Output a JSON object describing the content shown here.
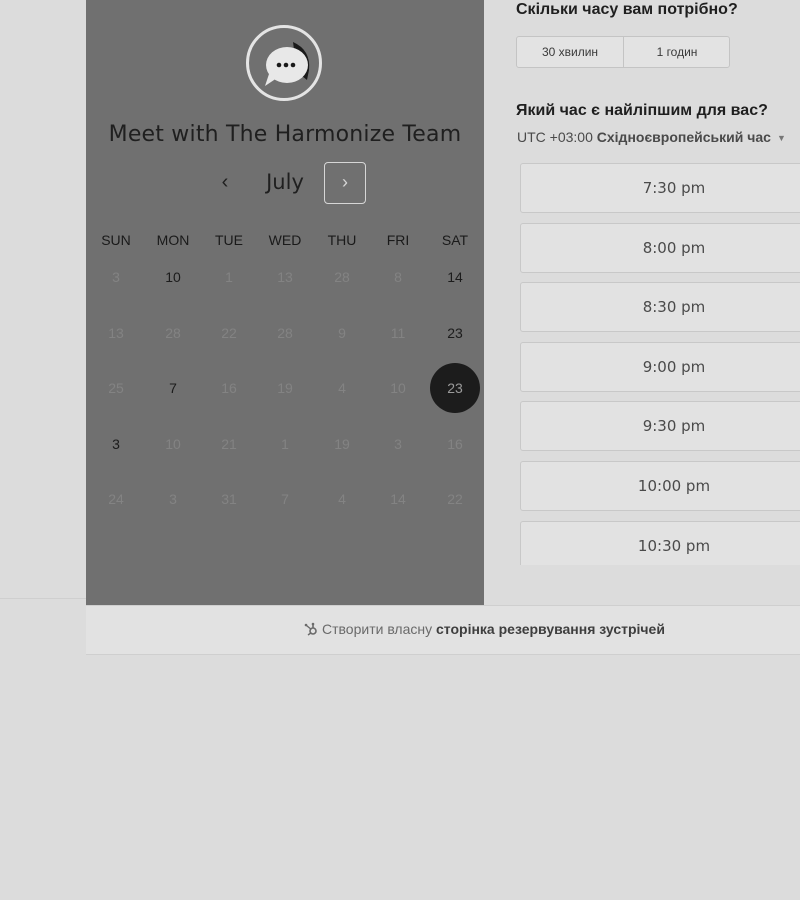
{
  "left_panel": {
    "logo_icon": "chat-bubble-icon",
    "title": "Meet with The Harmonize Team",
    "month": "July",
    "prev_icon": "‹",
    "next_icon": "›",
    "day_headers": [
      "SUN",
      "MON",
      "TUE",
      "WED",
      "THU",
      "FRI",
      "SAT"
    ],
    "weeks": [
      [
        {
          "d": "3",
          "a": false
        },
        {
          "d": "10",
          "a": true
        },
        {
          "d": "1",
          "a": false
        },
        {
          "d": "13",
          "a": false
        },
        {
          "d": "28",
          "a": false
        },
        {
          "d": "8",
          "a": false
        },
        {
          "d": "14",
          "a": true
        }
      ],
      [
        {
          "d": "13",
          "a": false
        },
        {
          "d": "28",
          "a": false
        },
        {
          "d": "22",
          "a": false
        },
        {
          "d": "28",
          "a": false
        },
        {
          "d": "9",
          "a": false
        },
        {
          "d": "11",
          "a": false
        },
        {
          "d": "23",
          "a": true
        }
      ],
      [
        {
          "d": "25",
          "a": false
        },
        {
          "d": "7",
          "a": true
        },
        {
          "d": "16",
          "a": false
        },
        {
          "d": "19",
          "a": false
        },
        {
          "d": "4",
          "a": false
        },
        {
          "d": "10",
          "a": false
        },
        {
          "d": "23",
          "a": true,
          "s": true
        }
      ],
      [
        {
          "d": "3",
          "a": true
        },
        {
          "d": "10",
          "a": false
        },
        {
          "d": "21",
          "a": false
        },
        {
          "d": "1",
          "a": false
        },
        {
          "d": "19",
          "a": false
        },
        {
          "d": "3",
          "a": false
        },
        {
          "d": "16",
          "a": false
        }
      ],
      [
        {
          "d": "24",
          "a": false
        },
        {
          "d": "3",
          "a": false
        },
        {
          "d": "31",
          "a": false
        },
        {
          "d": "7",
          "a": false
        },
        {
          "d": "4",
          "a": false
        },
        {
          "d": "14",
          "a": false
        },
        {
          "d": "22",
          "a": false
        }
      ]
    ]
  },
  "right_panel": {
    "duration_question": "Скільки часу вам потрібно?",
    "durations": [
      "30 хвилин",
      "1 годин"
    ],
    "time_question": "Який час є найліпшим для вас?",
    "tz_offset": "UTC +03:00",
    "tz_name": "Східноєвропейський час",
    "slots": [
      "7:30 pm",
      "8:00 pm",
      "8:30 pm",
      "9:00 pm",
      "9:30 pm",
      "10:00 pm",
      "10:30 pm"
    ]
  },
  "footer": {
    "icon": "hubspot-icon",
    "prefix": "Створити власну",
    "link": "сторінка резервування зустрічей"
  },
  "colors": {
    "panel": "#707070",
    "page": "#dcdcdc",
    "selected_day": "#1c1c1c"
  }
}
